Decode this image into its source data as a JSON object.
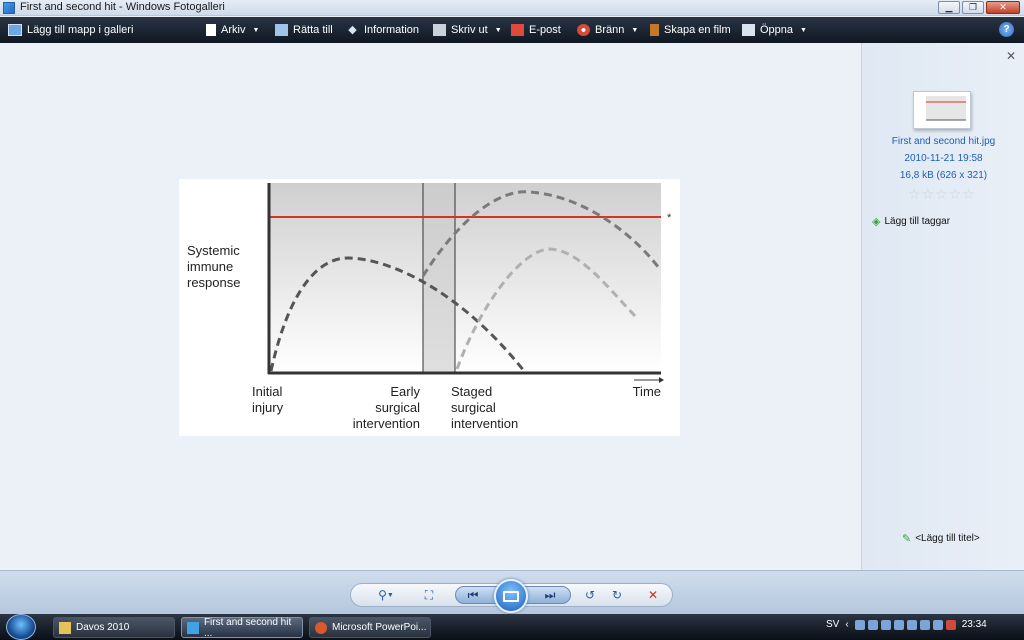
{
  "window": {
    "title": "First and second hit - Windows Fotogalleri"
  },
  "menu": {
    "add_folder": "Lägg till mapp i galleri",
    "items": [
      {
        "label": "Arkiv",
        "icon": "file-icon",
        "has_caret": true
      },
      {
        "label": "Rätta till",
        "icon": "fix-icon",
        "has_caret": false
      },
      {
        "label": "Information",
        "icon": "info-tag-icon",
        "has_caret": false
      },
      {
        "label": "Skriv ut",
        "icon": "printer-icon",
        "has_caret": true
      },
      {
        "label": "E-post",
        "icon": "email-icon",
        "has_caret": false
      },
      {
        "label": "Bränn",
        "icon": "burn-disc-icon",
        "has_caret": true
      },
      {
        "label": "Skapa en film",
        "icon": "film-icon",
        "has_caret": false
      },
      {
        "label": "Öppna",
        "icon": "open-icon",
        "has_caret": true
      }
    ],
    "help": "?"
  },
  "figure": {
    "ylabel_lines": [
      "Systemic",
      "immune",
      "response"
    ],
    "xlabels": [
      {
        "lines": [
          "Initial",
          "injury"
        ]
      },
      {
        "lines": [
          "Early",
          "surgical",
          "intervention"
        ]
      },
      {
        "lines": [
          "Staged",
          "surgical",
          "intervention"
        ]
      },
      {
        "lines": [
          "Time"
        ]
      }
    ],
    "asterisk": "*"
  },
  "sidepanel": {
    "filename": "First and second hit.jpg",
    "date": "2010-11-21    19:58",
    "size": "16,8 kB (626 x 321)",
    "rating": 0,
    "add_tags": "Lägg till taggar",
    "add_title": "<Lägg till titel>"
  },
  "taskbar": {
    "tasks": [
      {
        "label": "Davos 2010"
      },
      {
        "label": "First and second hit ..."
      },
      {
        "label": "Microsoft PowerPoi..."
      }
    ],
    "lang": "SV",
    "clock": "23:34"
  }
}
